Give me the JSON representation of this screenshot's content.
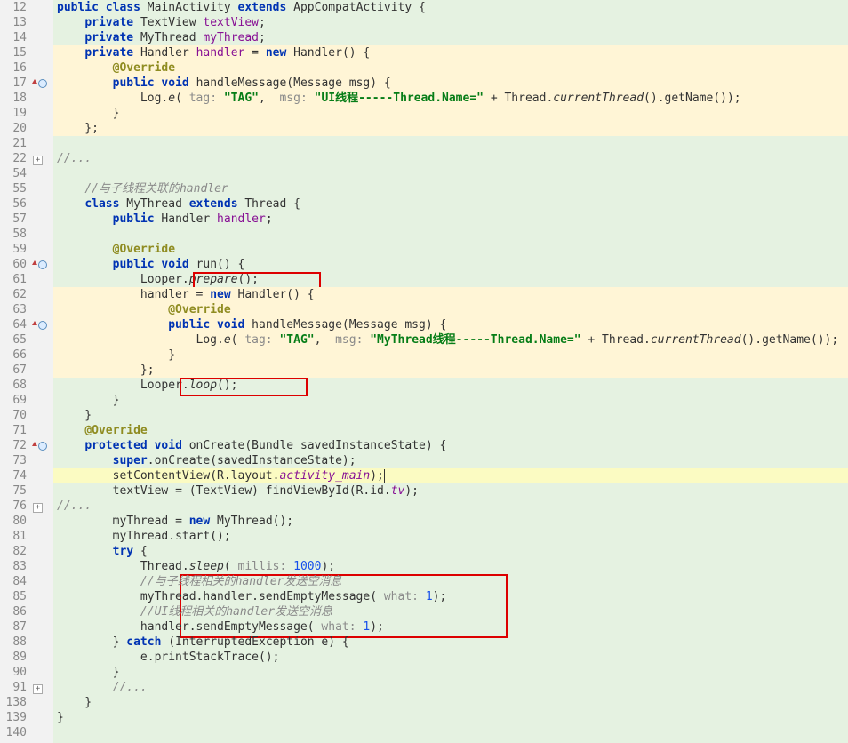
{
  "lines": {
    "l12": [
      "public",
      "class",
      "MainActivity",
      "extends",
      "AppCompatActivity {"
    ],
    "l13": [
      "private",
      "TextView",
      "textView",
      ";"
    ],
    "l14": [
      "private",
      "MyThread",
      "myThread",
      ";"
    ],
    "l15": [
      "private",
      "Handler",
      "handler",
      " = ",
      "new",
      "Handler() {"
    ],
    "l16": "@Override",
    "l17": [
      "public",
      "void",
      "handleMessage(Message msg) {"
    ],
    "l18_tag": "\"TAG\"",
    "l18_msg": "\"UI线程-----Thread.Name=\"",
    "l18_hint1": "tag:",
    "l18_hint2": "msg:",
    "l18_call": "currentThread",
    "l18_call2": ".getName());",
    "l55": "//与子线程关联的handler",
    "l56": [
      "class",
      "MyThread",
      "extends",
      "Thread {"
    ],
    "l57": [
      "public",
      "Handler",
      "handler",
      ";"
    ],
    "l59": "@Override",
    "l60": [
      "public",
      "void",
      "run() {"
    ],
    "l61": [
      "Looper.",
      "prepare",
      "();"
    ],
    "l62": [
      "handler = ",
      "new",
      "Handler() {"
    ],
    "l63": "@Override",
    "l64": [
      "public",
      "void",
      "handleMessage(Message msg) {"
    ],
    "l65_tag": "\"TAG\"",
    "l65_msg": "\"MyThread线程-----Thread.Name=\"",
    "l68": [
      "Looper.",
      "loop",
      "();"
    ],
    "l71": "@Override",
    "l72": [
      "protected",
      "void",
      "onCreate(Bundle savedInstanceState) {"
    ],
    "l73": [
      "super",
      ".onCreate(savedInstanceState);"
    ],
    "l74": [
      "setContentView(R.layout.",
      "activity_main",
      ");"
    ],
    "l75": [
      "textView = (TextView) findViewById(R.id.",
      "tv",
      ");"
    ],
    "l80": [
      "myThread = ",
      "new",
      "MyThread();"
    ],
    "l81": "myThread.start();",
    "l82": [
      "try",
      " {"
    ],
    "l83": [
      "Thread.",
      "sleep",
      "(",
      "millis:",
      "1000",
      ");"
    ],
    "l84": "//与子线程相关的handler发送空消息",
    "l85": [
      "myThread.handler.sendEmptyMessage(",
      "what:",
      "1",
      ");"
    ],
    "l86": "//UI线程相关的handler发送空消息",
    "l87": [
      "handler.sendEmptyMessage(",
      "what:",
      "1",
      ");"
    ],
    "l88": [
      "} ",
      "catch",
      " (InterruptedException e) {"
    ],
    "l89": "e.printStackTrace();",
    "ellipsis": "...",
    "commentEllipsis": "//..."
  },
  "lineNumbers": [
    "12",
    "13",
    "14",
    "15",
    "16",
    "17",
    "18",
    "19",
    "20",
    "21",
    "22",
    "54",
    "55",
    "56",
    "57",
    "58",
    "59",
    "60",
    "61",
    "62",
    "63",
    "64",
    "65",
    "66",
    "67",
    "68",
    "69",
    "70",
    "71",
    "72",
    "73",
    "74",
    "75",
    "76",
    "80",
    "81",
    "82",
    "83",
    "84",
    "85",
    "86",
    "87",
    "88",
    "89",
    "90",
    "91",
    "138",
    "139",
    "140"
  ]
}
